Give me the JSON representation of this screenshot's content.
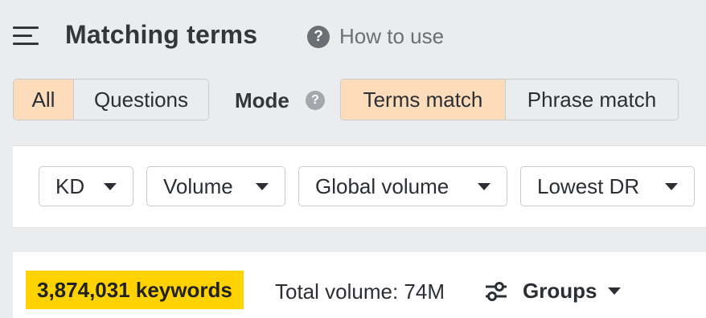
{
  "header": {
    "title": "Matching terms",
    "help_label": "How to use",
    "help_glyph": "?"
  },
  "type_filter": {
    "options": [
      "All",
      "Questions"
    ],
    "selected": "All"
  },
  "mode": {
    "label": "Mode",
    "help_glyph": "?",
    "options": [
      "Terms match",
      "Phrase match"
    ],
    "selected": "Terms match"
  },
  "filters": [
    {
      "label": "KD"
    },
    {
      "label": "Volume"
    },
    {
      "label": "Global volume"
    },
    {
      "label": "Lowest DR"
    }
  ],
  "results": {
    "keyword_count": "3,874,031 keywords",
    "total_volume": "Total volume: 74M",
    "groups_label": "Groups"
  },
  "icons": {
    "menu": "hamburger-menu-icon",
    "help": "question-circle-icon",
    "dropdown": "caret-down-icon",
    "groups": "sliders-icon"
  },
  "colors": {
    "active_segment": "#fcdcbb",
    "keyword_highlight": "#ffd200",
    "page_background": "#ebeced"
  }
}
